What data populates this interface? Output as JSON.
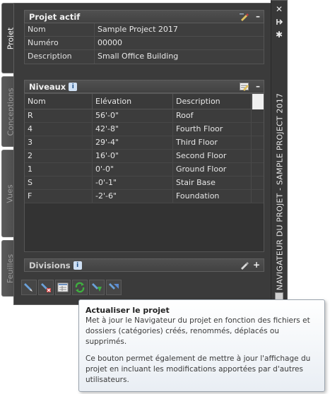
{
  "tabs": [
    {
      "label": "Projet",
      "active": true
    },
    {
      "label": "Conceptions",
      "active": false
    },
    {
      "label": "Vues",
      "active": false
    },
    {
      "label": "Feuilles",
      "active": false
    }
  ],
  "titlebar": {
    "title": "NAVIGATEUR DU PROJET - SAMPLE PROJECT 2017",
    "close_icon": "close-icon",
    "autohide_icon": "autohide-icon",
    "settings_icon": "settings-icon"
  },
  "projet_actif": {
    "header": "Projet actif",
    "collapse": "–",
    "rows": [
      {
        "key": "Nom",
        "value": "Sample Project 2017"
      },
      {
        "key": "Numéro",
        "value": "00000"
      },
      {
        "key": "Description",
        "value": "Small Office Building"
      }
    ]
  },
  "niveaux": {
    "header": "Niveaux",
    "info": "i",
    "collapse": "–",
    "columns": [
      "Nom",
      "Elévation",
      "Description"
    ],
    "rows": [
      {
        "nom": "R",
        "elevation": "56'-0\"",
        "description": "Roof"
      },
      {
        "nom": "4",
        "elevation": "42'-8\"",
        "description": "Fourth Floor"
      },
      {
        "nom": "3",
        "elevation": "29'-4\"",
        "description": "Third Floor"
      },
      {
        "nom": "2",
        "elevation": "16'-0\"",
        "description": "Second Floor"
      },
      {
        "nom": "1",
        "elevation": "0'-0\"",
        "description": "Ground Floor"
      },
      {
        "nom": "S",
        "elevation": "-0'-1\"",
        "description": "Stair Base"
      },
      {
        "nom": "F",
        "elevation": "-2'-6\"",
        "description": "Foundation"
      }
    ]
  },
  "divisions": {
    "header": "Divisions",
    "info": "i",
    "expand": "+"
  },
  "tooltip": {
    "title": "Actualiser le projet",
    "p1": "Met à jour le Navigateur du projet en fonction des fichiers et dossiers (catégories) créés, renommés, déplacés ou supprimés.",
    "p2": "Ce bouton permet également de mettre à jour l'affichage du projet en incluant les modifications apportées par d'autres utilisateurs."
  }
}
